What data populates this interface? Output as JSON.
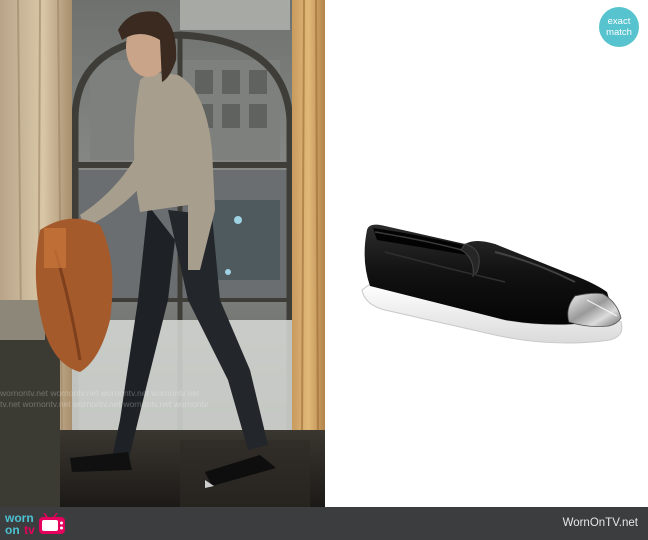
{
  "badge": {
    "line1": "exact",
    "line2": "match"
  },
  "watermark": {
    "line1": "wornontv.net  wornontv.net  wornontv.net  wornontv.net",
    "line2": "tv.net  wornontv.net  wornontv.net  wornontv.net  wornontv"
  },
  "footer": {
    "brand_worn": "worn",
    "brand_on": "on",
    "brand_tv": "tv",
    "site": "WornOnTV.net"
  },
  "colors": {
    "badge": "#56c3cf",
    "footer_bg": "#3c3d3f",
    "brand_teal": "#4dc2d2",
    "brand_pink": "#e4005c"
  },
  "icons": [
    "tv-logo-icon",
    "shoe-product-image",
    "scene-photo"
  ]
}
